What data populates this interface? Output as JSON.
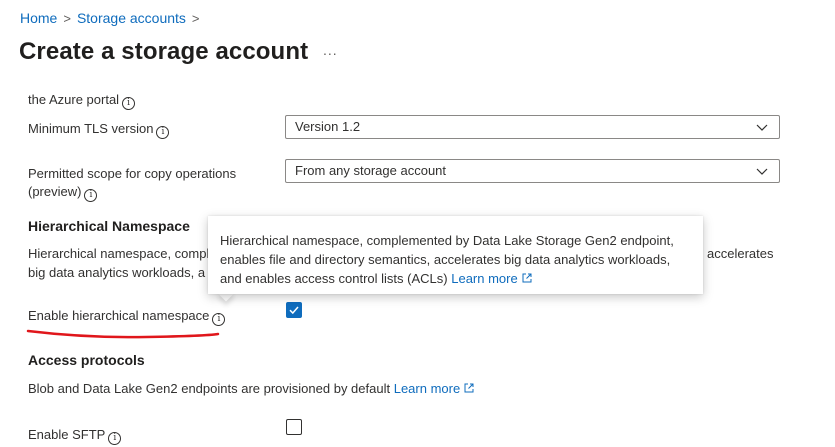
{
  "breadcrumb": {
    "items": [
      "Home",
      "Storage accounts"
    ],
    "separator": ">"
  },
  "page": {
    "title": "Create a storage account",
    "more_label": "..."
  },
  "form": {
    "azure_portal_label": "the Azure portal",
    "tls": {
      "label": "Minimum TLS version",
      "value": "Version 1.2"
    },
    "copy_scope": {
      "label_line1": "Permitted scope for copy operations",
      "label_line2": "(preview)",
      "value": "From any storage account"
    },
    "hierarchical": {
      "heading": "Hierarchical Namespace",
      "desc_line1_visible": "Hierarchical namespace, compl",
      "desc_line1_right": "accelerates",
      "desc_line2_visible": "big data analytics workloads, a",
      "enable_label": "Enable hierarchical namespace",
      "enabled": true
    },
    "access_protocols": {
      "heading": "Access protocols",
      "desc": "Blob and Data Lake Gen2 endpoints are provisioned by default",
      "learn_more": "Learn more"
    },
    "sftp": {
      "label": "Enable SFTP",
      "enabled": false
    }
  },
  "tooltip": {
    "line1": "Hierarchical namespace, complemented by Data Lake Storage Gen2 endpoint,",
    "line2": "enables file and directory semantics, accelerates big data analytics workloads,",
    "line3": "and enables access control lists (ACLs)",
    "learn_more": "Learn more"
  },
  "colors": {
    "accent": "#0f6cbd",
    "annotation_underline": "#e0161b"
  }
}
